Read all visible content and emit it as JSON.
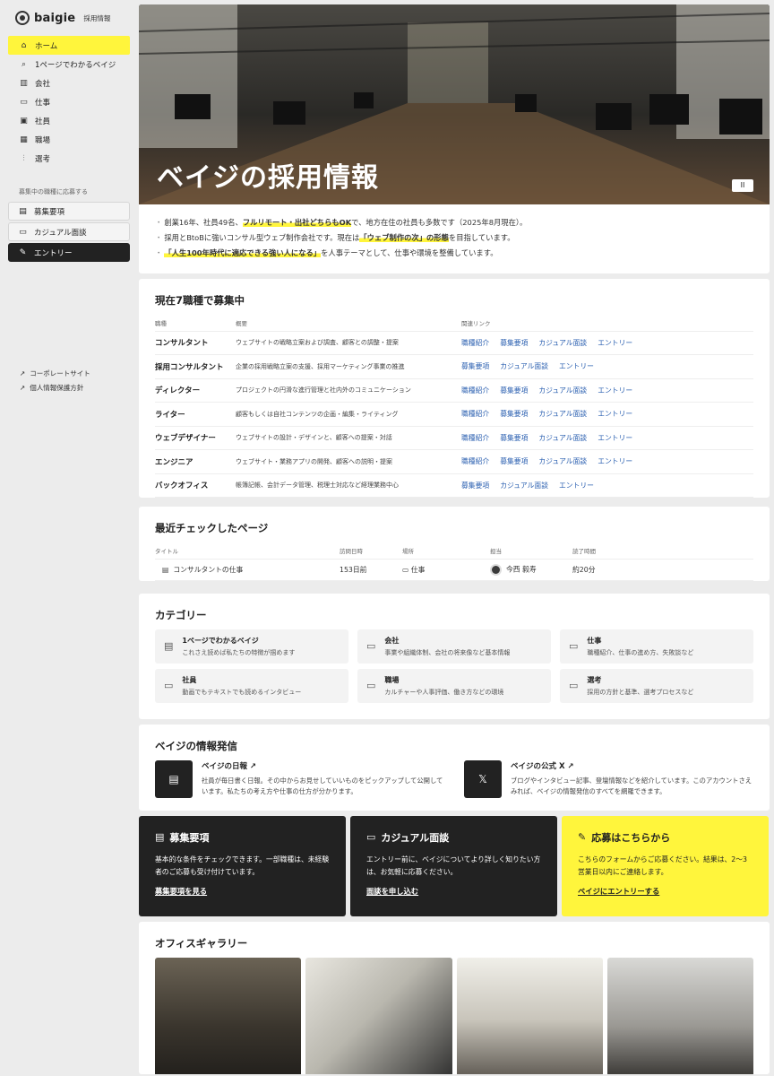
{
  "brand": {
    "name": "baigie",
    "sub": "採用情報"
  },
  "sidebar": {
    "nav": [
      {
        "label": "ホーム",
        "icon": "home-icon",
        "active": true
      },
      {
        "label": "1ページでわかるベイジ",
        "icon": "search-icon"
      },
      {
        "label": "会社",
        "icon": "chart-icon"
      },
      {
        "label": "仕事",
        "icon": "monitor-icon"
      },
      {
        "label": "社員",
        "icon": "person-icon"
      },
      {
        "label": "職場",
        "icon": "building-icon"
      },
      {
        "label": "選考",
        "icon": "flow-icon"
      }
    ],
    "caption": "募集中の職種に応募する",
    "buttons": [
      {
        "label": "募集要項"
      },
      {
        "label": "カジュアル面談"
      },
      {
        "label": "エントリー"
      }
    ],
    "links": [
      {
        "label": "コーポレートサイト"
      },
      {
        "label": "個人情報保護方針"
      }
    ]
  },
  "hero": {
    "title": "ベイジの採用情報",
    "pause": "II",
    "bullets": [
      {
        "pre": "創業16年、社員49名、",
        "hl": "フルリモート・出社どちらもOK",
        "post": "で、地方在住の社員も多数です（2025年8月現在）。"
      },
      {
        "pre": "採用とBtoBに強いコンサル型ウェブ制作会社です。現在は",
        "hl": "「ウェブ制作の次」の形態",
        "post": "を目指しています。"
      },
      {
        "pre": "",
        "hl": "「人生100年時代に適応できる強い人になる」",
        "post": "を人事テーマとして、仕事や環境を整備しています。"
      }
    ]
  },
  "jobs": {
    "title": "現在7職種で募集中",
    "headers": [
      "職種",
      "概要",
      "関連リンク"
    ],
    "rows": [
      {
        "name": "コンサルタント",
        "desc": "ウェブサイトの戦略立案および調査、顧客との調整・提案",
        "links": [
          "職種紹介",
          "募集要項",
          "カジュアル面談",
          "エントリー"
        ]
      },
      {
        "name": "採用コンサルタント",
        "desc": "企業の採用戦略立案の支援、採用マーケティング事業の推進",
        "links": [
          "募集要項",
          "カジュアル面談",
          "エントリー"
        ]
      },
      {
        "name": "ディレクター",
        "desc": "プロジェクトの円滑な進行管理と社内外のコミュニケーション",
        "links": [
          "職種紹介",
          "募集要項",
          "カジュアル面談",
          "エントリー"
        ]
      },
      {
        "name": "ライター",
        "desc": "顧客もしくは自社コンテンツの企画・編集・ライティング",
        "links": [
          "職種紹介",
          "募集要項",
          "カジュアル面談",
          "エントリー"
        ]
      },
      {
        "name": "ウェブデザイナー",
        "desc": "ウェブサイトの設計・デザインと、顧客への提案・対話",
        "links": [
          "職種紹介",
          "募集要項",
          "カジュアル面談",
          "エントリー"
        ]
      },
      {
        "name": "エンジニア",
        "desc": "ウェブサイト・業務アプリの開発、顧客への説明・提案",
        "links": [
          "職種紹介",
          "募集要項",
          "カジュアル面談",
          "エントリー"
        ]
      },
      {
        "name": "バックオフィス",
        "desc": "帳簿記帳、会計データ管理、税理士対応など経理業務中心",
        "links": [
          "募集要項",
          "カジュアル面談",
          "エントリー"
        ]
      }
    ]
  },
  "recent": {
    "title": "最近チェックしたページ",
    "headers": [
      "タイトル",
      "訪問日時",
      "場所",
      "担当",
      "読了時間"
    ],
    "rows": [
      {
        "title": "コンサルタントの仕事",
        "visited": "153日前",
        "place": "仕事",
        "person": "今西 毅寿",
        "time": "約20分"
      }
    ]
  },
  "categories": {
    "title": "カテゴリー",
    "items": [
      {
        "title": "1ページでわかるベイジ",
        "desc": "これさえ読めば私たちの特徴が掴めます",
        "icon": "document-icon"
      },
      {
        "title": "会社",
        "desc": "事業や組織体制、会社の将来像など基本情報",
        "icon": "folder-icon"
      },
      {
        "title": "仕事",
        "desc": "職種紹介、仕事の進め方、失敗談など",
        "icon": "folder-icon"
      },
      {
        "title": "社員",
        "desc": "動画でもテキストでも読めるインタビュー",
        "icon": "folder-icon"
      },
      {
        "title": "職場",
        "desc": "カルチャーや人事評価、働き方などの環境",
        "icon": "folder-icon"
      },
      {
        "title": "選考",
        "desc": "採用の方針と基準、選考プロセスなど",
        "icon": "folder-icon"
      }
    ]
  },
  "info": {
    "title": "ベイジの情報発信",
    "items": [
      {
        "title": "ベイジの日報",
        "desc": "社員が毎日書く日報。その中からお見せしていいものをピックアップして公開しています。私たちの考え方や仕事の仕方が分かります。",
        "badge": "▤"
      },
      {
        "title": "ベイジの公式 X",
        "desc": "ブログやインタビュー記事、登壇情報などを紹介しています。このアカウントさえみれば、ベイジの情報発信のすべてを網羅できます。",
        "badge": "𝕏"
      }
    ]
  },
  "cta": [
    {
      "title": "募集要項",
      "desc": "基本的な条件をチェックできます。一部職種は、未経験者のご応募も受け付けています。",
      "link": "募集要項を見る"
    },
    {
      "title": "カジュアル面談",
      "desc": "エントリー前に、ベイジについてより詳しく知りたい方は、お気軽に応募ください。",
      "link": "面談を申し込む"
    },
    {
      "title": "応募はこちらから",
      "desc": "こちらのフォームからご応募ください。結果は、2〜3営業日以内にご連絡します。",
      "link": "ベイジにエントリーする"
    }
  ],
  "gallery": {
    "title": "オフィスギャラリー"
  }
}
